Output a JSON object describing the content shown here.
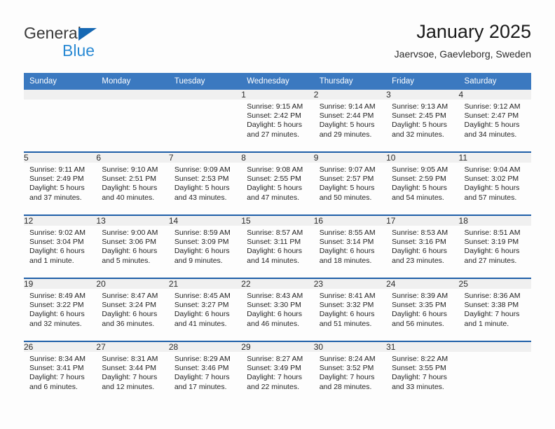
{
  "brand": {
    "word1": "General",
    "word2": "Blue",
    "triangle_color": "#1668b3",
    "blue_color": "#2a8ad4"
  },
  "header": {
    "title": "January 2025",
    "subtitle": "Jaervsoe, Gaevleborg, Sweden"
  },
  "theme": {
    "header_bg": "#3b79c0",
    "row_separator": "#1f5fa8",
    "daynum_bg": "#f0f0f0"
  },
  "calendar": {
    "weekday_headers": [
      "Sunday",
      "Monday",
      "Tuesday",
      "Wednesday",
      "Thursday",
      "Friday",
      "Saturday"
    ],
    "labels": {
      "sunrise": "Sunrise:",
      "sunset": "Sunset:",
      "daylight": "Daylight:"
    },
    "weeks": [
      [
        {
          "day": "",
          "empty": true
        },
        {
          "day": "",
          "empty": true
        },
        {
          "day": "",
          "empty": true
        },
        {
          "day": "1",
          "sunrise": "Sunrise: 9:15 AM",
          "sunset": "Sunset: 2:42 PM",
          "daylight1": "Daylight: 5 hours",
          "daylight2": "and 27 minutes."
        },
        {
          "day": "2",
          "sunrise": "Sunrise: 9:14 AM",
          "sunset": "Sunset: 2:44 PM",
          "daylight1": "Daylight: 5 hours",
          "daylight2": "and 29 minutes."
        },
        {
          "day": "3",
          "sunrise": "Sunrise: 9:13 AM",
          "sunset": "Sunset: 2:45 PM",
          "daylight1": "Daylight: 5 hours",
          "daylight2": "and 32 minutes."
        },
        {
          "day": "4",
          "sunrise": "Sunrise: 9:12 AM",
          "sunset": "Sunset: 2:47 PM",
          "daylight1": "Daylight: 5 hours",
          "daylight2": "and 34 minutes."
        }
      ],
      [
        {
          "day": "5",
          "sunrise": "Sunrise: 9:11 AM",
          "sunset": "Sunset: 2:49 PM",
          "daylight1": "Daylight: 5 hours",
          "daylight2": "and 37 minutes."
        },
        {
          "day": "6",
          "sunrise": "Sunrise: 9:10 AM",
          "sunset": "Sunset: 2:51 PM",
          "daylight1": "Daylight: 5 hours",
          "daylight2": "and 40 minutes."
        },
        {
          "day": "7",
          "sunrise": "Sunrise: 9:09 AM",
          "sunset": "Sunset: 2:53 PM",
          "daylight1": "Daylight: 5 hours",
          "daylight2": "and 43 minutes."
        },
        {
          "day": "8",
          "sunrise": "Sunrise: 9:08 AM",
          "sunset": "Sunset: 2:55 PM",
          "daylight1": "Daylight: 5 hours",
          "daylight2": "and 47 minutes."
        },
        {
          "day": "9",
          "sunrise": "Sunrise: 9:07 AM",
          "sunset": "Sunset: 2:57 PM",
          "daylight1": "Daylight: 5 hours",
          "daylight2": "and 50 minutes."
        },
        {
          "day": "10",
          "sunrise": "Sunrise: 9:05 AM",
          "sunset": "Sunset: 2:59 PM",
          "daylight1": "Daylight: 5 hours",
          "daylight2": "and 54 minutes."
        },
        {
          "day": "11",
          "sunrise": "Sunrise: 9:04 AM",
          "sunset": "Sunset: 3:02 PM",
          "daylight1": "Daylight: 5 hours",
          "daylight2": "and 57 minutes."
        }
      ],
      [
        {
          "day": "12",
          "sunrise": "Sunrise: 9:02 AM",
          "sunset": "Sunset: 3:04 PM",
          "daylight1": "Daylight: 6 hours",
          "daylight2": "and 1 minute."
        },
        {
          "day": "13",
          "sunrise": "Sunrise: 9:00 AM",
          "sunset": "Sunset: 3:06 PM",
          "daylight1": "Daylight: 6 hours",
          "daylight2": "and 5 minutes."
        },
        {
          "day": "14",
          "sunrise": "Sunrise: 8:59 AM",
          "sunset": "Sunset: 3:09 PM",
          "daylight1": "Daylight: 6 hours",
          "daylight2": "and 9 minutes."
        },
        {
          "day": "15",
          "sunrise": "Sunrise: 8:57 AM",
          "sunset": "Sunset: 3:11 PM",
          "daylight1": "Daylight: 6 hours",
          "daylight2": "and 14 minutes."
        },
        {
          "day": "16",
          "sunrise": "Sunrise: 8:55 AM",
          "sunset": "Sunset: 3:14 PM",
          "daylight1": "Daylight: 6 hours",
          "daylight2": "and 18 minutes."
        },
        {
          "day": "17",
          "sunrise": "Sunrise: 8:53 AM",
          "sunset": "Sunset: 3:16 PM",
          "daylight1": "Daylight: 6 hours",
          "daylight2": "and 23 minutes."
        },
        {
          "day": "18",
          "sunrise": "Sunrise: 8:51 AM",
          "sunset": "Sunset: 3:19 PM",
          "daylight1": "Daylight: 6 hours",
          "daylight2": "and 27 minutes."
        }
      ],
      [
        {
          "day": "19",
          "sunrise": "Sunrise: 8:49 AM",
          "sunset": "Sunset: 3:22 PM",
          "daylight1": "Daylight: 6 hours",
          "daylight2": "and 32 minutes."
        },
        {
          "day": "20",
          "sunrise": "Sunrise: 8:47 AM",
          "sunset": "Sunset: 3:24 PM",
          "daylight1": "Daylight: 6 hours",
          "daylight2": "and 36 minutes."
        },
        {
          "day": "21",
          "sunrise": "Sunrise: 8:45 AM",
          "sunset": "Sunset: 3:27 PM",
          "daylight1": "Daylight: 6 hours",
          "daylight2": "and 41 minutes."
        },
        {
          "day": "22",
          "sunrise": "Sunrise: 8:43 AM",
          "sunset": "Sunset: 3:30 PM",
          "daylight1": "Daylight: 6 hours",
          "daylight2": "and 46 minutes."
        },
        {
          "day": "23",
          "sunrise": "Sunrise: 8:41 AM",
          "sunset": "Sunset: 3:32 PM",
          "daylight1": "Daylight: 6 hours",
          "daylight2": "and 51 minutes."
        },
        {
          "day": "24",
          "sunrise": "Sunrise: 8:39 AM",
          "sunset": "Sunset: 3:35 PM",
          "daylight1": "Daylight: 6 hours",
          "daylight2": "and 56 minutes."
        },
        {
          "day": "25",
          "sunrise": "Sunrise: 8:36 AM",
          "sunset": "Sunset: 3:38 PM",
          "daylight1": "Daylight: 7 hours",
          "daylight2": "and 1 minute."
        }
      ],
      [
        {
          "day": "26",
          "sunrise": "Sunrise: 8:34 AM",
          "sunset": "Sunset: 3:41 PM",
          "daylight1": "Daylight: 7 hours",
          "daylight2": "and 6 minutes."
        },
        {
          "day": "27",
          "sunrise": "Sunrise: 8:31 AM",
          "sunset": "Sunset: 3:44 PM",
          "daylight1": "Daylight: 7 hours",
          "daylight2": "and 12 minutes."
        },
        {
          "day": "28",
          "sunrise": "Sunrise: 8:29 AM",
          "sunset": "Sunset: 3:46 PM",
          "daylight1": "Daylight: 7 hours",
          "daylight2": "and 17 minutes."
        },
        {
          "day": "29",
          "sunrise": "Sunrise: 8:27 AM",
          "sunset": "Sunset: 3:49 PM",
          "daylight1": "Daylight: 7 hours",
          "daylight2": "and 22 minutes."
        },
        {
          "day": "30",
          "sunrise": "Sunrise: 8:24 AM",
          "sunset": "Sunset: 3:52 PM",
          "daylight1": "Daylight: 7 hours",
          "daylight2": "and 28 minutes."
        },
        {
          "day": "31",
          "sunrise": "Sunrise: 8:22 AM",
          "sunset": "Sunset: 3:55 PM",
          "daylight1": "Daylight: 7 hours",
          "daylight2": "and 33 minutes."
        },
        {
          "day": "",
          "empty": true
        }
      ]
    ]
  }
}
